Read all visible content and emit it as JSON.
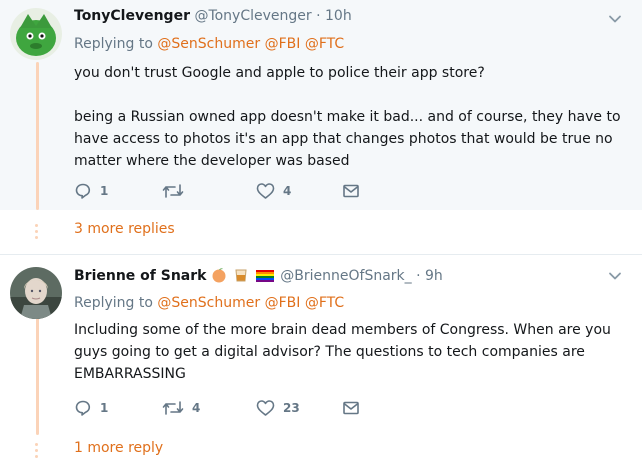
{
  "tweets": [
    {
      "name": "TonyClevenger",
      "handle": "@TonyClevenger",
      "separator": "·",
      "time": "10h",
      "replying_prefix": "Replying to",
      "mentions": [
        "@SenSchumer",
        "@FBI",
        "@FTC"
      ],
      "paragraphs": [
        "you don't trust Google and apple to police their app store?",
        "being a Russian owned app doesn't make it bad...  and of course, they have to have access to photos it's an app that changes photos that would be true no matter where the developer was based"
      ],
      "actions": {
        "replies": "1",
        "retweets": "",
        "likes": "4"
      },
      "more_replies": "3 more replies"
    },
    {
      "name": "Brienne of Snark",
      "handle": "@BrienneOfSnark_",
      "separator": "·",
      "time": "9h",
      "replying_prefix": "Replying to",
      "mentions": [
        "@SenSchumer",
        "@FBI",
        "@FTC"
      ],
      "paragraphs": [
        "Including some of the more brain dead members of Congress. When are you guys going to get a digital advisor? The questions to tech companies are EMBARRASSING"
      ],
      "actions": {
        "replies": "1",
        "retweets": "4",
        "likes": "23"
      },
      "more_replies": "1 more reply"
    }
  ],
  "icons": {
    "reply": "reply-icon",
    "retweet": "retweet-icon",
    "like": "heart-icon",
    "message": "envelope-icon",
    "caret": "chevron-down-icon"
  },
  "colors": {
    "accent": "#e0701c",
    "muted": "#657786",
    "thread_line": "#fbd3b8",
    "focused_bg": "#f5f8fa"
  }
}
